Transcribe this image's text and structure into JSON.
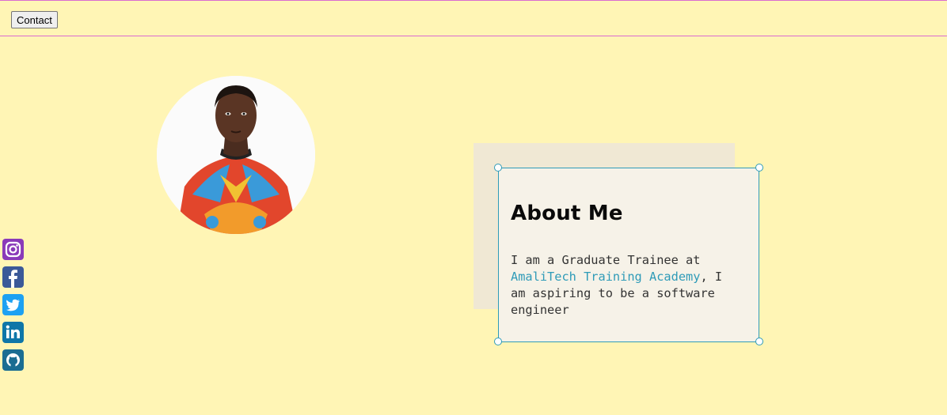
{
  "header": {
    "contact_label": "Contact"
  },
  "profile": {
    "photo_alt": "Profile photo"
  },
  "social": [
    {
      "name": "instagram-icon",
      "color": "#8a3ab9"
    },
    {
      "name": "facebook-icon",
      "color": "#3b5998"
    },
    {
      "name": "twitter-icon",
      "color": "#1da1f2"
    },
    {
      "name": "linkedin-icon",
      "color": "#0e76a8"
    },
    {
      "name": "github-icon",
      "color": "#1b6d92"
    }
  ],
  "about": {
    "title": "About Me",
    "text_before": "I am a Graduate Trainee at ",
    "link_text": "AmaliTech Training Academy",
    "text_after": ", I am aspiring to be a software engineer"
  },
  "colors": {
    "background": "#fff5b5",
    "accent": "#2f9bb8",
    "divider": "#d96bd1"
  }
}
